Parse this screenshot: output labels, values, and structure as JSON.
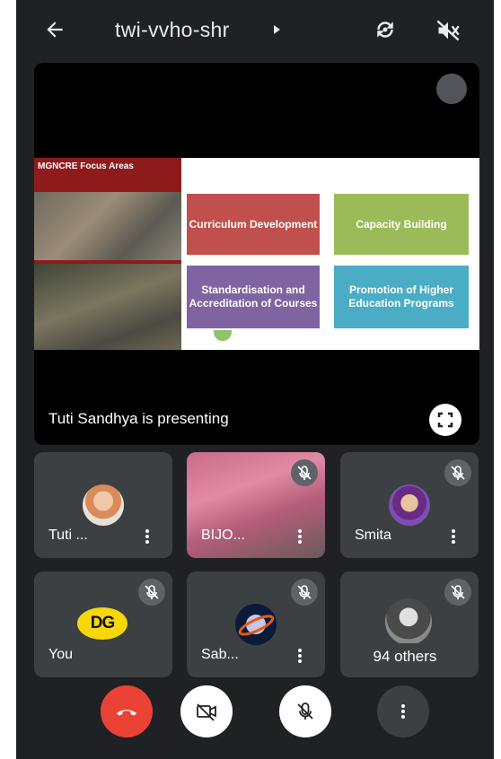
{
  "topbar": {
    "meeting_code": "twi-vvho-shr",
    "back_icon": "arrow-left-icon",
    "switch_camera_icon": "switch-camera-icon",
    "speaker_icon": "speaker-off-icon"
  },
  "stage": {
    "presenter_label": "Tuti Sandhya is presenting",
    "slide": {
      "title": "MGNCRE Focus Areas",
      "boxes": [
        {
          "label": "Curriculum Development",
          "color": "#c0504d"
        },
        {
          "label": "Capacity Building",
          "color": "#9bbb59"
        },
        {
          "label": "Standardisation and Accreditation of Courses",
          "color": "#8064a2"
        },
        {
          "label": "Promotion of Higher Education Programs",
          "color": "#4bacc6"
        }
      ]
    }
  },
  "participants": [
    {
      "name": "Tuti ...",
      "muted": false
    },
    {
      "name": "BIJO...",
      "muted": true
    },
    {
      "name": "Smita",
      "muted": true
    },
    {
      "name": "You",
      "muted": true,
      "avatar_text": "DG"
    },
    {
      "name": "Sab...",
      "muted": true
    },
    {
      "others": "94 others",
      "muted": true
    }
  ],
  "controls": {
    "hangup_icon": "end-call-icon",
    "camera_icon": "camera-off-icon",
    "mic_icon": "mic-off-icon",
    "more_icon": "more-vert-icon"
  },
  "colors": {
    "background": "#202124",
    "tile": "#3c4043",
    "hangup": "#ea4335"
  }
}
